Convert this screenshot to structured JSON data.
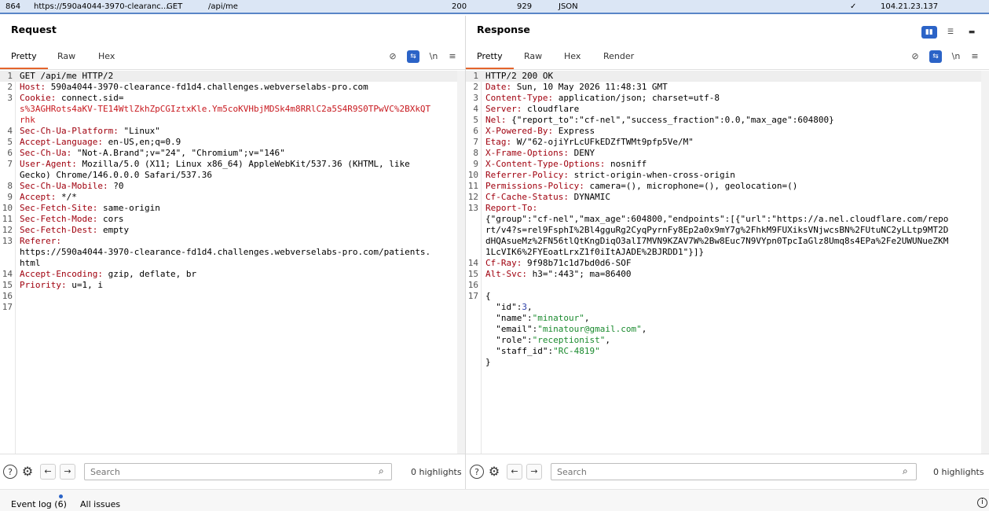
{
  "history_row": {
    "id": "864",
    "host": "https://590a4044-3970-clearanc...",
    "method": "GET",
    "path": "/api/me",
    "status": "200",
    "length": "929",
    "mime": "JSON",
    "tls": "✓",
    "ip": "104.21.23.137"
  },
  "request": {
    "title": "Request",
    "tabs": [
      "Pretty",
      "Raw",
      "Hex"
    ],
    "active_tab": "Pretty",
    "newline_label": "\\n",
    "search_placeholder": "Search",
    "highlights": "0 highlights",
    "lines": [
      {
        "n": "1",
        "t": "GET /api/me HTTP/2"
      },
      {
        "n": "2",
        "k": "Host",
        "v": " 590a4044-3970-clearance-fd1d4.challenges.webverselabs-pro.com"
      },
      {
        "n": "3",
        "k": "Cookie",
        "v": " connect.sid="
      },
      {
        "n": "",
        "c": "s%3AGHRots4aKV-TE14WtlZkhZpCGIztxKle.Ym5coKVHbjMDSk4m8RRlC2a5S4R9S0TPwVC%2BXkQT"
      },
      {
        "n": "",
        "c": "rhk"
      },
      {
        "n": "4",
        "k": "Sec-Ch-Ua-Platform",
        "v": " \"Linux\""
      },
      {
        "n": "5",
        "k": "Accept-Language",
        "v": " en-US,en;q=0.9"
      },
      {
        "n": "6",
        "k": "Sec-Ch-Ua",
        "v": " \"Not-A.Brand\";v=\"24\", \"Chromium\";v=\"146\""
      },
      {
        "n": "7",
        "k": "User-Agent",
        "v": " Mozilla/5.0 (X11; Linux x86_64) AppleWebKit/537.36 (KHTML, like"
      },
      {
        "n": "",
        "t": "Gecko) Chrome/146.0.0.0 Safari/537.36"
      },
      {
        "n": "8",
        "k": "Sec-Ch-Ua-Mobile",
        "v": " ?0"
      },
      {
        "n": "9",
        "k": "Accept",
        "v": " */*"
      },
      {
        "n": "10",
        "k": "Sec-Fetch-Site",
        "v": " same-origin"
      },
      {
        "n": "11",
        "k": "Sec-Fetch-Mode",
        "v": " cors"
      },
      {
        "n": "12",
        "k": "Sec-Fetch-Dest",
        "v": " empty"
      },
      {
        "n": "13",
        "k": "Referer",
        "v": ""
      },
      {
        "n": "",
        "t": "https://590a4044-3970-clearance-fd1d4.challenges.webverselabs-pro.com/patients."
      },
      {
        "n": "",
        "t": "html"
      },
      {
        "n": "14",
        "k": "Accept-Encoding",
        "v": " gzip, deflate, br"
      },
      {
        "n": "15",
        "k": "Priority",
        "v": " u=1, i"
      },
      {
        "n": "16",
        "t": ""
      },
      {
        "n": "17",
        "t": ""
      }
    ]
  },
  "response": {
    "title": "Response",
    "tabs": [
      "Pretty",
      "Raw",
      "Hex",
      "Render"
    ],
    "active_tab": "Pretty",
    "newline_label": "\\n",
    "search_placeholder": "Search",
    "highlights": "0 highlights",
    "lines": [
      {
        "n": "1",
        "t": "HTTP/2 200 OK"
      },
      {
        "n": "2",
        "k": "Date",
        "v": " Sun, 10 May 2026 11:48:31 GMT"
      },
      {
        "n": "3",
        "k": "Content-Type",
        "v": " application/json; charset=utf-8"
      },
      {
        "n": "4",
        "k": "Server",
        "v": " cloudflare"
      },
      {
        "n": "5",
        "k": "Nel",
        "v": " {\"report_to\":\"cf-nel\",\"success_fraction\":0.0,\"max_age\":604800}"
      },
      {
        "n": "6",
        "k": "X-Powered-By",
        "v": " Express"
      },
      {
        "n": "7",
        "k": "Etag",
        "v": " W/\"62-ojiYrLcUFkEDZfTWMt9pfp5Ve/M\""
      },
      {
        "n": "8",
        "k": "X-Frame-Options",
        "v": " DENY"
      },
      {
        "n": "9",
        "k": "X-Content-Type-Options",
        "v": " nosniff"
      },
      {
        "n": "10",
        "k": "Referrer-Policy",
        "v": " strict-origin-when-cross-origin"
      },
      {
        "n": "11",
        "k": "Permissions-Policy",
        "v": " camera=(), microphone=(), geolocation=()"
      },
      {
        "n": "12",
        "k": "Cf-Cache-Status",
        "v": " DYNAMIC"
      },
      {
        "n": "13",
        "k": "Report-To",
        "v": ""
      },
      {
        "n": "",
        "t": "{\"group\":\"cf-nel\",\"max_age\":604800,\"endpoints\":[{\"url\":\"https://a.nel.cloudflare.com/repo"
      },
      {
        "n": "",
        "t": "rt/v4?s=rel9FsphI%2Bl4gguRg2CyqPyrnFy8Ep2a0x9mY7g%2FhkM9FUXiksVNjwcsBN%2FUtuNC2yLLtp9MT2D"
      },
      {
        "n": "",
        "t": "dHQAsueMz%2FN56tlQtKngDiqO3alI7MVN9KZAV7W%2Bw8Euc7N9VYpn0TpcIaGlz8Umq8s4EPa%2Fe2UWUNueZKM"
      },
      {
        "n": "",
        "t": "1LcVIK6%2FYEoatLrxZ1f0iItAJADE%2BJRDD1\"}]}"
      },
      {
        "n": "14",
        "k": "Cf-Ray",
        "v": " 9f98b71c1d7bd0d6-SOF"
      },
      {
        "n": "15",
        "k": "Alt-Svc",
        "v": " h3=\":443\"; ma=86400"
      },
      {
        "n": "16",
        "t": ""
      },
      {
        "n": "17",
        "t": "{"
      },
      {
        "n": "",
        "jk": "  \"id\"",
        "jsep": ":",
        "jnum": "3",
        "tail": ","
      },
      {
        "n": "",
        "jk": "  \"name\"",
        "jsep": ":",
        "jstr": "\"minatour\"",
        "tail": ","
      },
      {
        "n": "",
        "jk": "  \"email\"",
        "jsep": ":",
        "jstr": "\"minatour@gmail.com\"",
        "tail": ","
      },
      {
        "n": "",
        "jk": "  \"role\"",
        "jsep": ":",
        "jstr": "\"receptionist\"",
        "tail": ","
      },
      {
        "n": "",
        "jk": "  \"staff_id\"",
        "jsep": ":",
        "jstr": "\"RC-4819\"",
        "tail": ""
      },
      {
        "n": "",
        "t": "}"
      }
    ]
  },
  "footer": {
    "event_log": "Event log (6)",
    "all_issues": "All issues",
    "event_dot_color": "#2b63c7"
  },
  "icons": {
    "help": "?",
    "settings": "⚙",
    "back": "←",
    "forward": "→",
    "search": "⌕",
    "menu": "≡",
    "hide": "⊘",
    "wrap": "⇆",
    "info": "i"
  }
}
